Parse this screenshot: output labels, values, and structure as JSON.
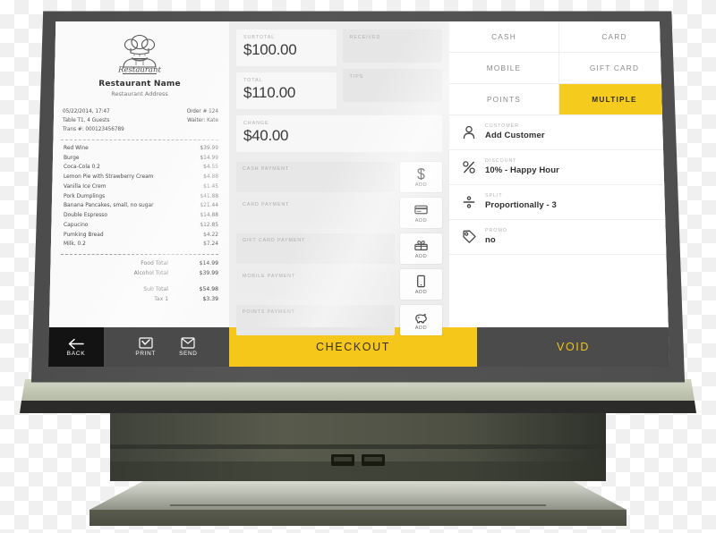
{
  "receipt": {
    "logo_icon": "chef-logo",
    "logo_script": "Restaurant",
    "name": "Restaurant Name",
    "address": "Restaurant Address",
    "meta": {
      "datetime": "05/22/2014,  17:47",
      "order": "Order # 124",
      "table": "Table T1, 4 Guests",
      "waiter": "Waiter: Kate",
      "trans": "Trans #: 000123456789"
    },
    "items": [
      {
        "name": "Red Wine",
        "price": "$39.99"
      },
      {
        "name": "Burge",
        "price": "$14.99"
      },
      {
        "name": "Coca-Cola 0.2",
        "price": "$4.55"
      },
      {
        "name": "Lemon Pie with Strawberry Cream",
        "price": "$4.88"
      },
      {
        "name": "Vanilla Ice Crem",
        "price": "$1.45"
      },
      {
        "name": "Pork Dumplings",
        "price": "$41.88"
      },
      {
        "name": "Banana Pancakes, small, no sugar",
        "price": "$21.44"
      },
      {
        "name": "Double Espresso",
        "price": "$14.88"
      },
      {
        "name": "Capucino",
        "price": "$12.85"
      },
      {
        "name": "Pumking Bread",
        "price": "$4.22"
      },
      {
        "name": "Milk, 0.2",
        "price": "$7.24"
      }
    ],
    "totals_group_1": [
      {
        "label": "Food Total",
        "value": "$14.99"
      },
      {
        "label": "Alcohol Total",
        "value": "$39.99"
      }
    ],
    "totals_group_2": [
      {
        "label": "Sub Total",
        "value": "$54.98"
      },
      {
        "label": "Tax 1",
        "value": "$3.39"
      }
    ]
  },
  "summary": {
    "subtotal": {
      "label": "SUBTOTAL",
      "value": "$100.00"
    },
    "received": {
      "label": "RECEIVED",
      "value": ""
    },
    "total": {
      "label": "TOTAL",
      "value": "$110.00"
    },
    "tips": {
      "label": "TIPS",
      "value": ""
    },
    "change": {
      "label": "CHANGE",
      "value": "$40.00"
    }
  },
  "payments": {
    "add_label": "ADD",
    "rows": [
      {
        "label": "CASH PAYMENT",
        "icon": "dollar-icon"
      },
      {
        "label": "CARD PAYMENT",
        "icon": "credit-card-icon"
      },
      {
        "label": "GIFT CARD PAYMENT",
        "icon": "gift-icon"
      },
      {
        "label": "MOBILE PAYMENT",
        "icon": "mobile-icon"
      },
      {
        "label": "POINTS PAYMENT",
        "icon": "piggy-bank-icon"
      }
    ]
  },
  "methods": [
    {
      "label": "CASH",
      "active": false
    },
    {
      "label": "CARD",
      "active": false
    },
    {
      "label": "MOBILE",
      "active": false
    },
    {
      "label": "GIFT CARD",
      "active": false
    },
    {
      "label": "POINTS",
      "active": false
    },
    {
      "label": "MULTIPLE",
      "active": true
    }
  ],
  "options": [
    {
      "label": "CUSTOMER",
      "value": "Add Customer",
      "icon": "person-icon"
    },
    {
      "label": "DISCOUNT",
      "value": "10% - Happy Hour",
      "icon": "percent-icon"
    },
    {
      "label": "SPLIT",
      "value": "Proportionally - 3",
      "icon": "divide-icon"
    },
    {
      "label": "PROMO",
      "value": "no",
      "icon": "tag-icon"
    }
  ],
  "bottom_bar": {
    "back": {
      "label": "BACK",
      "icon": "arrow-left-icon"
    },
    "print": {
      "label": "PRINT",
      "icon": "print-icon"
    },
    "send": {
      "label": "SEND",
      "icon": "envelope-icon"
    },
    "checkout": "CHECKOUT",
    "void": "VOID"
  },
  "colors": {
    "accent_yellow": "#F5CC1E",
    "checkout_yellow": "#F5C71B",
    "bezel_gray": "#4f4f4f",
    "void_text": "#F0C419"
  }
}
